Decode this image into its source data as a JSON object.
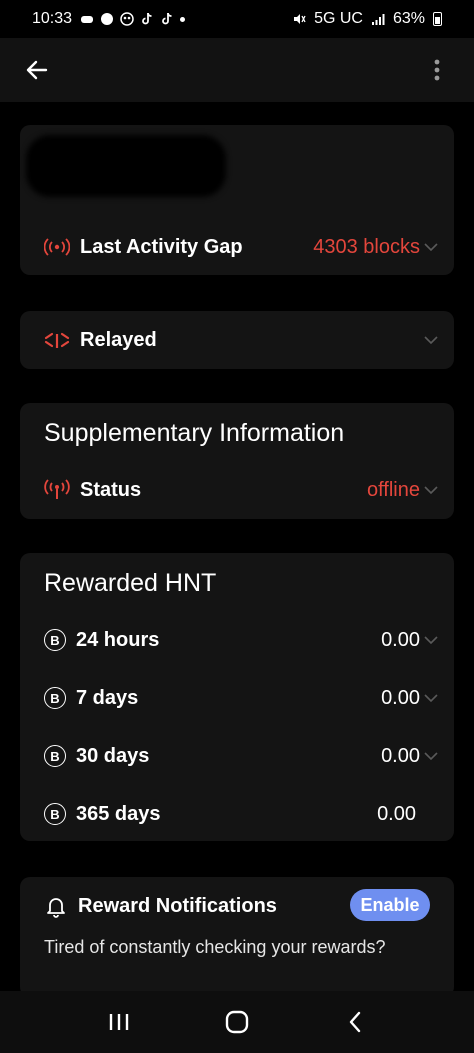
{
  "status_bar": {
    "time": "10:33",
    "network": "5G UC",
    "battery": "63%"
  },
  "app_bar": {
    "back_icon": "arrow-left-icon",
    "menu_icon": "more-vert-icon"
  },
  "activity_card": {
    "label": "Last Activity Gap",
    "value": "4303 blocks"
  },
  "relay_card": {
    "label": "Relayed"
  },
  "supplementary": {
    "title": "Supplementary Information",
    "status_label": "Status",
    "status_value": "offline"
  },
  "rewards": {
    "title": "Rewarded HNT",
    "items": [
      {
        "label": "24 hours",
        "value": "0.00"
      },
      {
        "label": "7 days",
        "value": "0.00"
      },
      {
        "label": "30 days",
        "value": "0.00"
      },
      {
        "label": "365 days",
        "value": "0.00"
      }
    ]
  },
  "notifications": {
    "title": "Reward Notifications",
    "enable_label": "Enable",
    "body": "Tired of constantly checking your rewards?"
  },
  "colors": {
    "accent_red": "#e3463c",
    "enable_blue": "#6f8ff0",
    "card_bg": "#141414"
  }
}
